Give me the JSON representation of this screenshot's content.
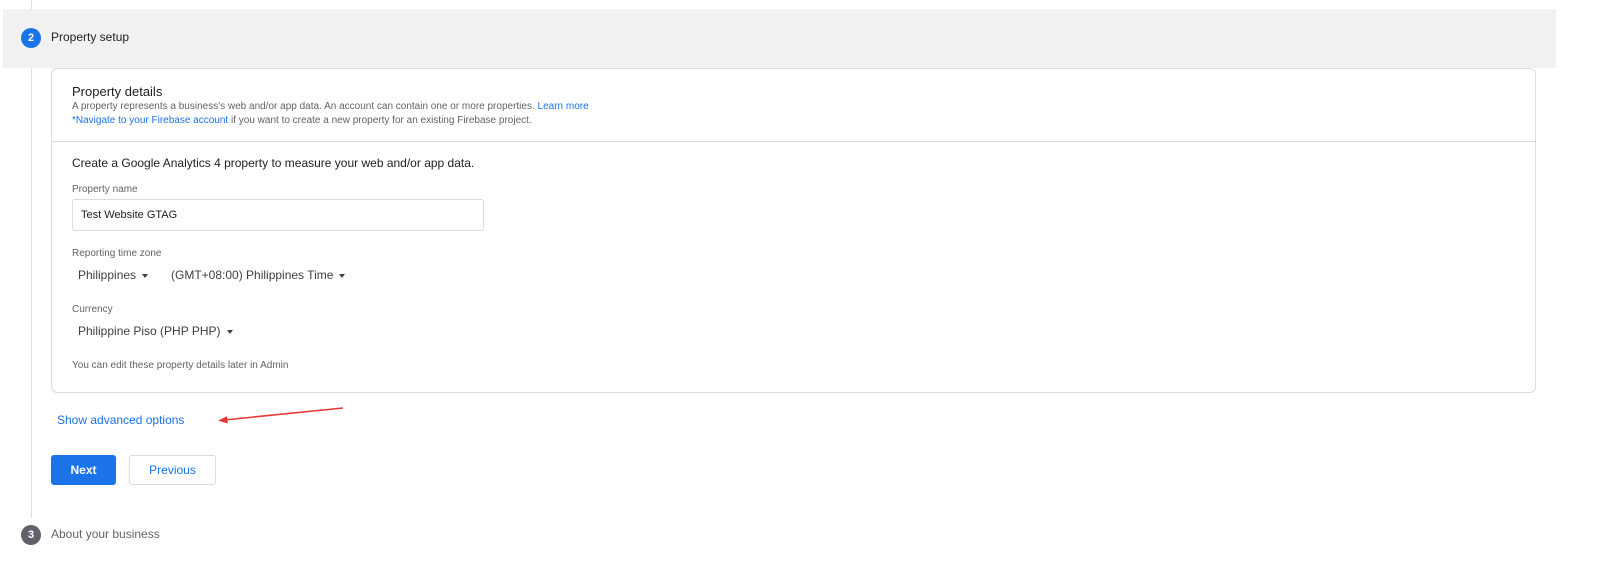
{
  "stepper": {
    "active_step": {
      "number": "2",
      "title": "Property setup"
    },
    "next_step": {
      "number": "3",
      "title": "About your business"
    }
  },
  "property_details": {
    "title": "Property details",
    "desc_line1": "A property represents a business's web and/or app data. An account can contain one or more properties.",
    "learn_more": "Learn more",
    "firebase_link": "*Navigate to your Firebase account",
    "desc_line2_rest": " if you want to create a new property for an existing Firebase project.",
    "intro": "Create a Google Analytics 4 property to measure your web and/or app data.",
    "property_name": {
      "label": "Property name",
      "value": "Test Website GTAG"
    },
    "time_zone": {
      "label": "Reporting time zone",
      "country": "Philippines",
      "zone": "(GMT+08:00) Philippines Time"
    },
    "currency": {
      "label": "Currency",
      "value": "Philippine Piso (PHP PHP)"
    },
    "footnote": "You can edit these property details later in Admin"
  },
  "advanced_options_label": "Show advanced options",
  "buttons": {
    "next": "Next",
    "previous": "Previous"
  },
  "colors": {
    "accent": "#1a73e8",
    "annotation_arrow": "#e53935",
    "header_band": "#f1f1f1"
  },
  "icons": {
    "dropdown": "caret-down-icon",
    "annotation": "red-arrow-icon"
  }
}
